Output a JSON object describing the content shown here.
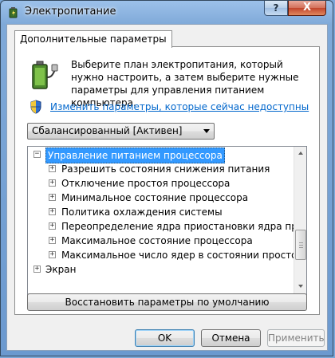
{
  "window": {
    "title": "Электропитание",
    "help_label": "?",
    "close_label": "X"
  },
  "tab": {
    "label": "Дополнительные параметры"
  },
  "description": "Выберите план электропитания, который нужно настроить, а затем выберите нужные параметры для управления питанием компьютера.",
  "link": {
    "label": "Изменить параметры, которые сейчас недоступны"
  },
  "plan": {
    "selected": "Сбалансированный [Активен]"
  },
  "tree": {
    "items": [
      {
        "expander": "−",
        "label": "Управление питанием процессора",
        "selected": true,
        "level": 0
      },
      {
        "expander": "+",
        "label": "Разрешить состояния снижения питания",
        "level": 1
      },
      {
        "expander": "+",
        "label": "Отключение простоя процессора",
        "level": 1
      },
      {
        "expander": "+",
        "label": "Минимальное состояние процессора",
        "level": 1
      },
      {
        "expander": "+",
        "label": "Политика охлаждения системы",
        "level": 1
      },
      {
        "expander": "+",
        "label": "Переопределение ядра приостановки ядра производительности",
        "level": 1
      },
      {
        "expander": "+",
        "label": "Максимальное состояние процессора",
        "level": 1
      },
      {
        "expander": "+",
        "label": "Максимальное число ядер в состоянии простоя",
        "level": 1
      },
      {
        "expander": "+",
        "label": "Экран",
        "level": 0
      }
    ]
  },
  "buttons": {
    "restore_defaults": "Восстановить параметры по умолчанию",
    "ok": "OK",
    "cancel": "Отмена",
    "apply": "Применить"
  },
  "colors": {
    "selection": "#3399ff",
    "link": "#0066cc",
    "frame": "#7fa9d8"
  }
}
